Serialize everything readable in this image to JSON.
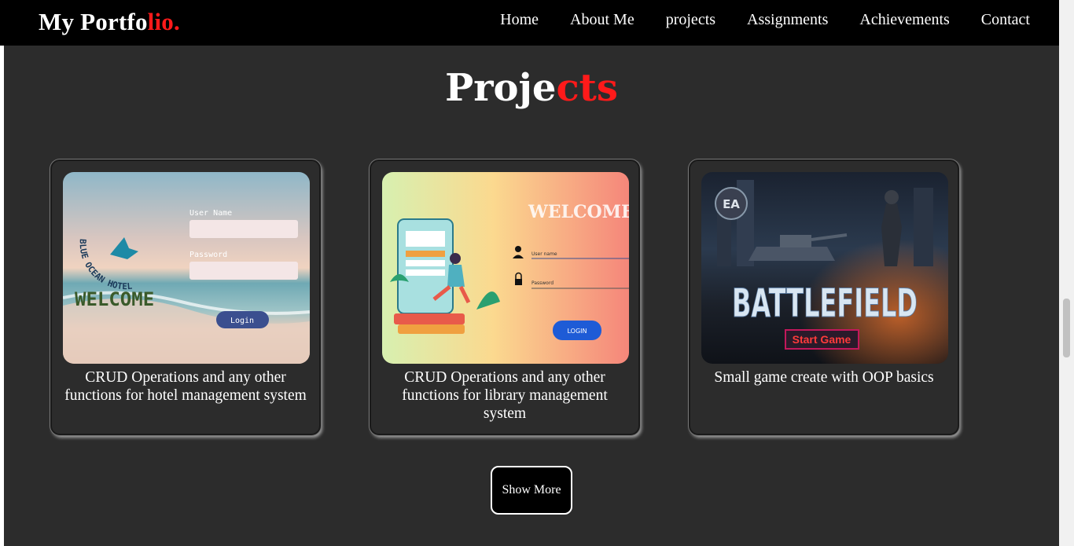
{
  "navbar": {
    "logo_main": "My Portfo",
    "logo_accent": "lio.",
    "links": [
      "Home",
      "About Me",
      "projects",
      "Assignments",
      "Achievements",
      "Contact"
    ]
  },
  "projects": {
    "heading_main": "Proje",
    "heading_accent": "cts",
    "cards": [
      {
        "caption": "CRUD Operations and any other functions for hotel management system",
        "image": {
          "brand": "BLUE OCEAN HOTEL",
          "welcome": "WELCOME",
          "user_label": "User Name",
          "password_label": "Password",
          "button": "Login"
        }
      },
      {
        "caption": "CRUD Operations and any other functions for library management system",
        "image": {
          "welcome": "WELCOME",
          "user_label": "User name",
          "password_label": "Password",
          "button": "LOGIN"
        }
      },
      {
        "caption": "Small game create with OOP basics",
        "image": {
          "title": "BATTLEFIELD",
          "button": "Start Game",
          "badge": "EA"
        }
      }
    ],
    "show_more": "Show More"
  },
  "colors": {
    "accent": "#ff1a1a",
    "navbar_bg": "#000000",
    "section_bg": "#2c2c2c"
  }
}
